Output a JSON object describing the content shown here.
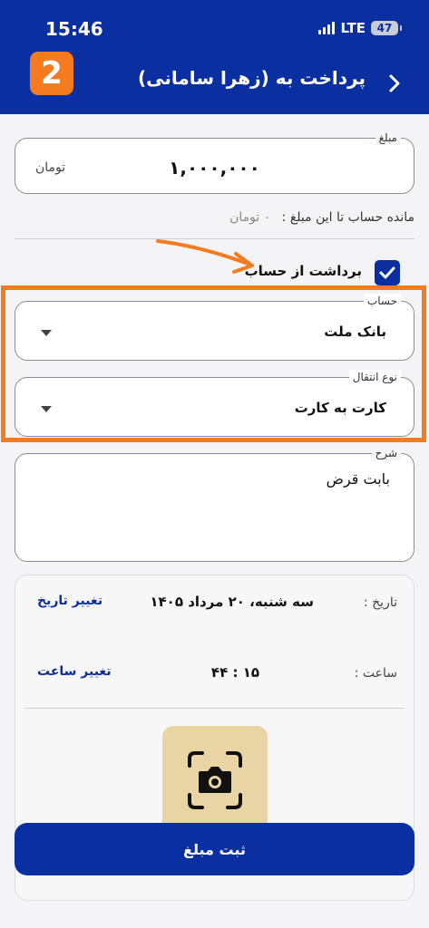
{
  "status_bar": {
    "time": "15:46",
    "network": "LTE",
    "battery": "47"
  },
  "header": {
    "badge": "2",
    "title": "پرداخت به (زهرا سامانی)"
  },
  "amount": {
    "label": "مبلغ",
    "value": "۱,۰۰۰,۰۰۰",
    "unit": "تومان"
  },
  "remaining": {
    "label": "مانده حساب تا این مبلغ :",
    "value": "۰ تومان"
  },
  "withdraw": {
    "label": "برداشت از حساب",
    "checked": true
  },
  "account": {
    "label": "حساب",
    "value": "بانک ملت"
  },
  "transfer": {
    "label": "نوع انتقال",
    "value": "کارت به کارت"
  },
  "description": {
    "label": "شرح",
    "value": "بابت قرض"
  },
  "date_row": {
    "label": "تاریخ :",
    "value": "سه شنبه، ۲۰ مرداد ۱۴۰۵",
    "action": "تغییر تاریخ"
  },
  "time_row": {
    "label": "ساعت :",
    "value": "۱۵ : ۴۴",
    "action": "تغییر ساعت"
  },
  "submit": {
    "label": "ثبت مبلغ"
  },
  "icons": [
    "back-chevron-icon",
    "camera-scan-icon",
    "check-icon",
    "caret-down-icon",
    "annotation-arrow-icon"
  ],
  "colors": {
    "primary": "#0a2fa0",
    "accent": "#f47b20",
    "camera_bg": "#e9d5a4"
  }
}
